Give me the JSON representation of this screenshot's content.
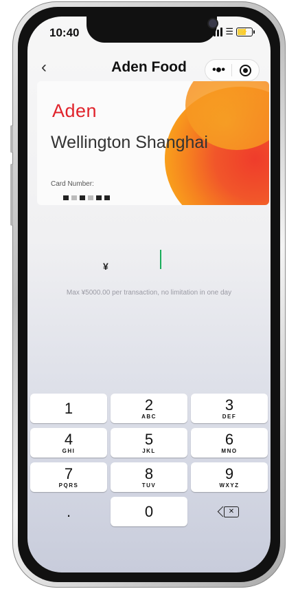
{
  "status_bar": {
    "time": "10:40"
  },
  "navbar": {
    "back_icon": "chevron-left-icon",
    "title": "Aden Food",
    "more_icon": "more-dots-icon",
    "close_icon": "target-close-icon"
  },
  "card": {
    "brand": "Aden",
    "location": "Wellington Shanghai",
    "card_number_label": "Card Number:",
    "brand_color": "#e0232b"
  },
  "payment": {
    "currency_symbol": "¥",
    "amount": "",
    "limit_text": "Max ¥5000.00 per transaction, no limitation in one day",
    "cursor_color": "#1aad5b"
  },
  "keypad": {
    "keys": [
      {
        "num": "1",
        "letters": ""
      },
      {
        "num": "2",
        "letters": "ABC"
      },
      {
        "num": "3",
        "letters": "DEF"
      },
      {
        "num": "4",
        "letters": "GHI"
      },
      {
        "num": "5",
        "letters": "JKL"
      },
      {
        "num": "6",
        "letters": "MNO"
      },
      {
        "num": "7",
        "letters": "PQRS"
      },
      {
        "num": "8",
        "letters": "TUV"
      },
      {
        "num": "9",
        "letters": "WXYZ"
      },
      {
        "num": ".",
        "letters": ""
      },
      {
        "num": "0",
        "letters": ""
      }
    ],
    "delete_icon": "backspace-icon"
  }
}
